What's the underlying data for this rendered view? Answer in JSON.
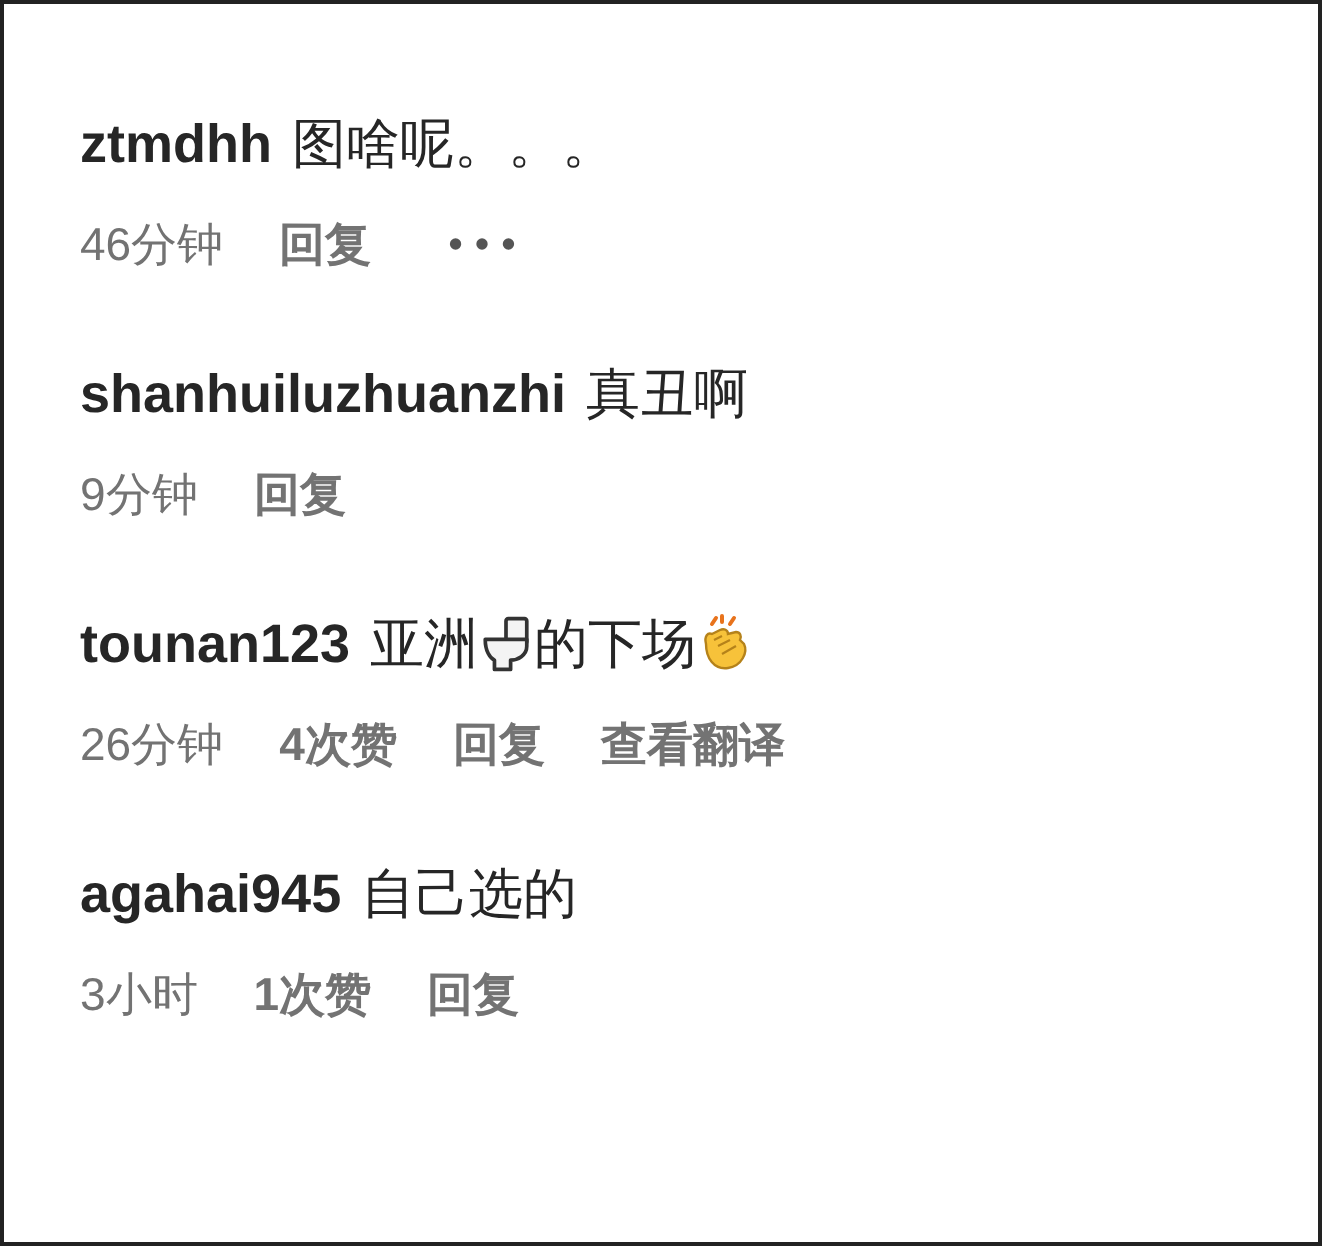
{
  "comments": [
    {
      "username": "ztmdhh",
      "parts": [
        {
          "kind": "text",
          "text": "图啥呢。。。"
        }
      ],
      "actions": [
        {
          "kind": "time",
          "text": "46分钟"
        },
        {
          "kind": "reply",
          "text": "回复"
        },
        {
          "kind": "more"
        }
      ]
    },
    {
      "username": "shanhuiluzhuanzhi",
      "parts": [
        {
          "kind": "text",
          "text": "真丑啊"
        }
      ],
      "actions": [
        {
          "kind": "time",
          "text": "9分钟"
        },
        {
          "kind": "reply",
          "text": "回复"
        }
      ]
    },
    {
      "username": "tounan123",
      "parts": [
        {
          "kind": "text",
          "text": "亚洲"
        },
        {
          "kind": "toilet"
        },
        {
          "kind": "text",
          "text": "的下场"
        },
        {
          "kind": "clap"
        }
      ],
      "actions": [
        {
          "kind": "time",
          "text": "26分钟"
        },
        {
          "kind": "likes",
          "text": "4次赞"
        },
        {
          "kind": "reply",
          "text": "回复"
        },
        {
          "kind": "translate",
          "text": "查看翻译"
        }
      ]
    },
    {
      "username": "agahai945",
      "parts": [
        {
          "kind": "text",
          "text": "自己选的"
        }
      ],
      "actions": [
        {
          "kind": "time",
          "text": "3小时"
        },
        {
          "kind": "likes",
          "text": "1次赞"
        },
        {
          "kind": "reply",
          "text": "回复"
        }
      ]
    }
  ]
}
